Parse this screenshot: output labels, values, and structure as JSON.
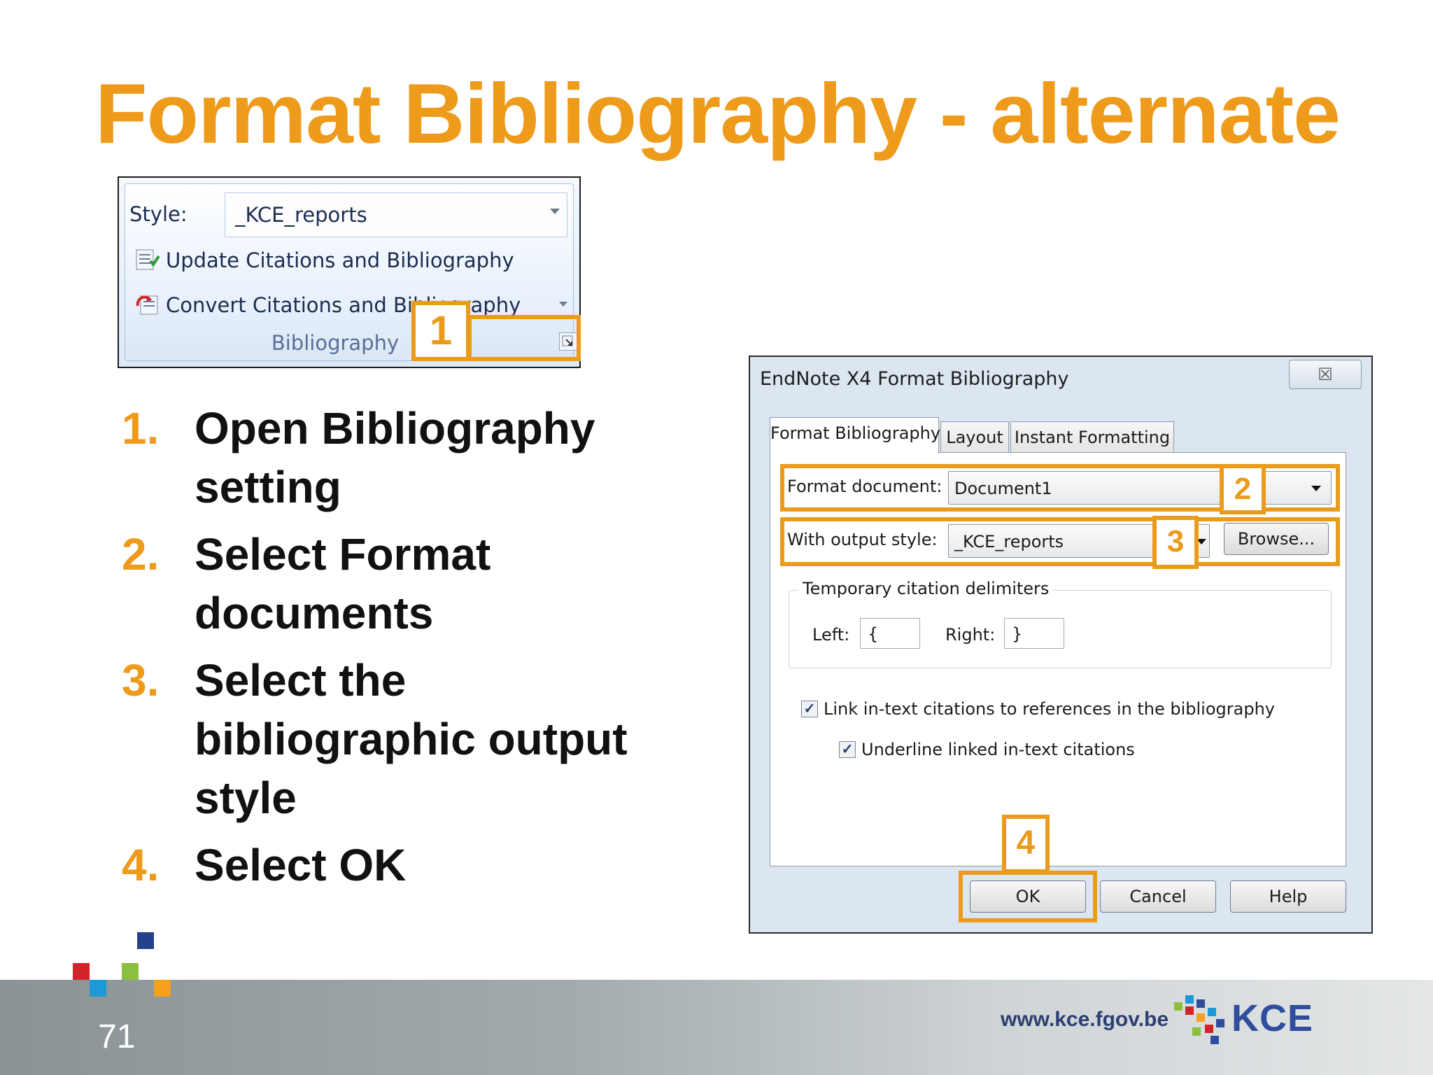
{
  "slide": {
    "title": "Format Bibliography - alternate",
    "page_number": "71"
  },
  "ribbon": {
    "style_label": "Style:",
    "style_value": "_KCE_reports",
    "update_label": "Update Citations and Bibliography",
    "convert_label": "Convert Citations and Bibliography",
    "group_label": "Bibliography",
    "callout": "1"
  },
  "steps": [
    {
      "num": "1.",
      "text": "Open Bibliography setting"
    },
    {
      "num": "2.",
      "text": "Select Format documents"
    },
    {
      "num": "3.",
      "text": "Select the bibliographic output style"
    },
    {
      "num": "4.",
      "text": "Select OK"
    }
  ],
  "dialog": {
    "title": "EndNote X4 Format Bibliography",
    "close_glyph": "☒",
    "tabs": [
      "Format Bibliography",
      "Layout",
      "Instant Formatting"
    ],
    "format_document_label": "Format document:",
    "format_document_value": "Document1",
    "output_style_label": "With output style:",
    "output_style_value": "_KCE_reports",
    "browse_label": "Browse...",
    "delimiters_group": "Temporary citation delimiters",
    "left_label": "Left:",
    "left_value": "{",
    "right_label": "Right:",
    "right_value": "}",
    "link_checkbox": "Link in-text citations to references in the bibliography",
    "underline_checkbox": "Underline linked in-text citations",
    "ok_label": "OK",
    "cancel_label": "Cancel",
    "help_label": "Help",
    "callouts": [
      "2",
      "3",
      "4"
    ]
  },
  "footer": {
    "url": "www.kce.fgov.be",
    "logo_text": "KCE"
  },
  "colors": {
    "accent": "#ee9a1a",
    "text": "#111111",
    "logo_blue": "#2e4d9c"
  }
}
